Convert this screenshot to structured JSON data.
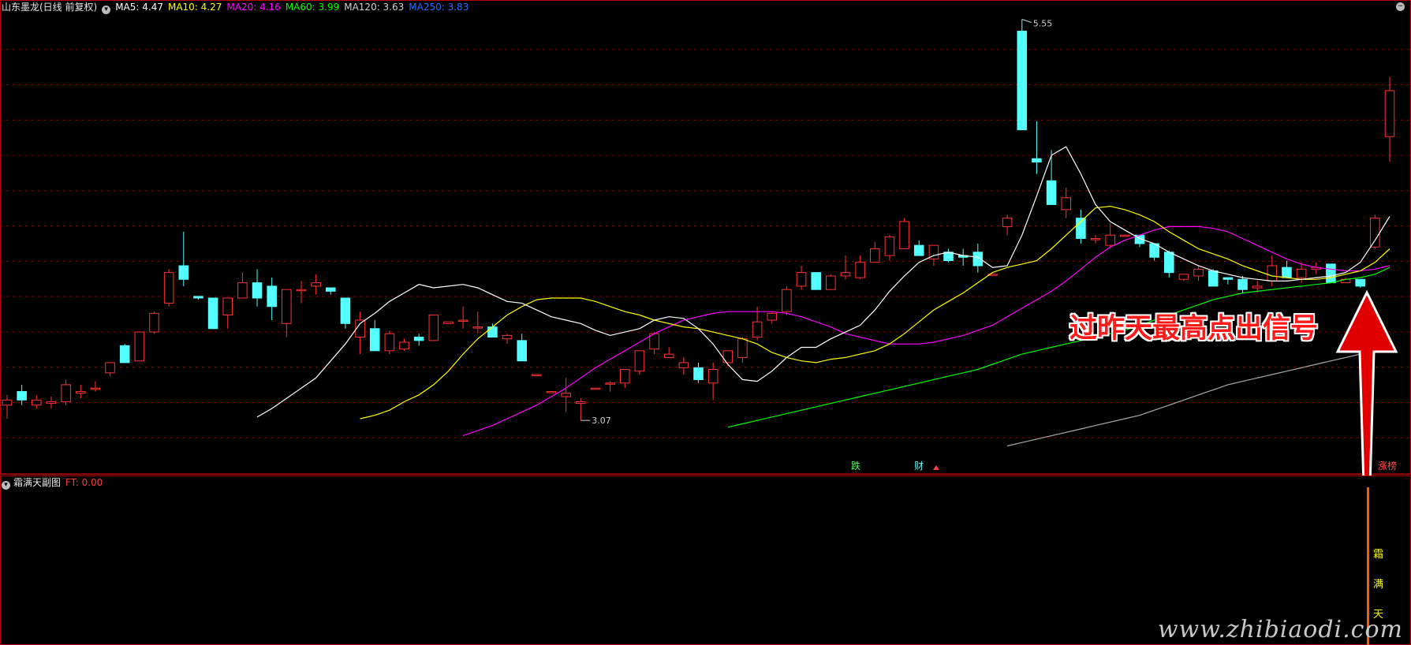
{
  "header": {
    "stock_name": "山东墨龙(日线 前复权)",
    "ma_items": [
      {
        "label": "MA5: 4.47",
        "color": "#ffffff"
      },
      {
        "label": "MA10: 4.27",
        "color": "#ffff00"
      },
      {
        "label": "MA20: 4.16",
        "color": "#ff00ff"
      },
      {
        "label": "MA60: 3.99",
        "color": "#00ff00"
      },
      {
        "label": "MA120: 3.63",
        "color": "#d0d0d0"
      },
      {
        "label": "MA250: 3.83",
        "color": "#1e6fff"
      }
    ]
  },
  "events": {
    "die": "跌",
    "cai": "财",
    "zhangting": "涨榜"
  },
  "signal_label": "过昨天最高点出信号",
  "sub_panel": {
    "title": "霜满天副图",
    "ft_label": "FT: 0.00",
    "vertical_chars": [
      "霜",
      "满",
      "天"
    ]
  },
  "watermark": "www.zhibiaodi.com",
  "chart_data": {
    "type": "candlestick",
    "ylim": [
      2.9,
      5.6
    ],
    "high_label": "5.55",
    "low_label": "3.07",
    "colors": {
      "up": "#ff3232",
      "down": "#54ffff",
      "ma5": "#ffffff",
      "ma10": "#ffff00",
      "ma20": "#ff00ff",
      "ma60": "#00ff00",
      "ma120": "#c8c8c8"
    },
    "candles": [
      {
        "o": 3.3,
        "h": 3.36,
        "l": 3.22,
        "c": 3.33
      },
      {
        "o": 3.38,
        "h": 3.42,
        "l": 3.3,
        "c": 3.33
      },
      {
        "o": 3.3,
        "h": 3.36,
        "l": 3.28,
        "c": 3.33
      },
      {
        "o": 3.31,
        "h": 3.35,
        "l": 3.28,
        "c": 3.32
      },
      {
        "o": 3.32,
        "h": 3.45,
        "l": 3.3,
        "c": 3.42
      },
      {
        "o": 3.37,
        "h": 3.42,
        "l": 3.34,
        "c": 3.38
      },
      {
        "o": 3.4,
        "h": 3.44,
        "l": 3.38,
        "c": 3.4
      },
      {
        "o": 3.49,
        "h": 3.54,
        "l": 3.47,
        "c": 3.55
      },
      {
        "o": 3.65,
        "h": 3.66,
        "l": 3.55,
        "c": 3.55
      },
      {
        "o": 3.56,
        "h": 3.72,
        "l": 3.56,
        "c": 3.73
      },
      {
        "o": 3.73,
        "h": 3.85,
        "l": 3.72,
        "c": 3.84
      },
      {
        "o": 3.9,
        "h": 4.1,
        "l": 3.88,
        "c": 4.08
      },
      {
        "o": 4.12,
        "h": 4.32,
        "l": 4.0,
        "c": 4.04
      },
      {
        "o": 3.94,
        "h": 3.94,
        "l": 3.92,
        "c": 3.93
      },
      {
        "o": 3.93,
        "h": 3.8,
        "l": 3.75,
        "c": 3.75
      },
      {
        "o": 3.83,
        "h": 3.9,
        "l": 3.75,
        "c": 3.93
      },
      {
        "o": 3.93,
        "h": 4.08,
        "l": 3.93,
        "c": 4.02
      },
      {
        "o": 4.02,
        "h": 4.1,
        "l": 3.88,
        "c": 3.93
      },
      {
        "o": 4.0,
        "h": 4.05,
        "l": 3.8,
        "c": 3.88
      },
      {
        "o": 3.78,
        "h": 3.95,
        "l": 3.7,
        "c": 3.98
      },
      {
        "o": 3.98,
        "h": 4.03,
        "l": 3.9,
        "c": 3.98
      },
      {
        "o": 4.0,
        "h": 4.07,
        "l": 3.95,
        "c": 4.02
      },
      {
        "o": 3.99,
        "h": 3.99,
        "l": 3.95,
        "c": 3.97
      },
      {
        "o": 3.93,
        "h": 3.9,
        "l": 3.75,
        "c": 3.78
      },
      {
        "o": 3.7,
        "h": 3.85,
        "l": 3.6,
        "c": 3.8
      },
      {
        "o": 3.75,
        "h": 3.8,
        "l": 3.62,
        "c": 3.62
      },
      {
        "o": 3.62,
        "h": 3.74,
        "l": 3.6,
        "c": 3.72
      },
      {
        "o": 3.63,
        "h": 3.69,
        "l": 3.62,
        "c": 3.67
      },
      {
        "o": 3.7,
        "h": 3.72,
        "l": 3.65,
        "c": 3.68
      },
      {
        "o": 3.68,
        "h": 3.82,
        "l": 3.68,
        "c": 3.83
      },
      {
        "o": 3.78,
        "h": 3.79,
        "l": 3.78,
        "c": 3.79
      },
      {
        "o": 3.8,
        "h": 3.88,
        "l": 3.75,
        "c": 3.8
      },
      {
        "o": 3.76,
        "h": 3.85,
        "l": 3.72,
        "c": 3.76
      },
      {
        "o": 3.76,
        "h": 3.78,
        "l": 3.7,
        "c": 3.7
      },
      {
        "o": 3.69,
        "h": 3.72,
        "l": 3.66,
        "c": 3.71
      },
      {
        "o": 3.68,
        "h": 3.72,
        "l": 3.56,
        "c": 3.56
      },
      {
        "o": 3.48,
        "h": 3.48,
        "l": 3.48,
        "c": 3.48
      },
      {
        "o": 3.38,
        "h": 3.38,
        "l": 3.38,
        "c": 3.38
      },
      {
        "o": 3.35,
        "h": 3.46,
        "l": 3.26,
        "c": 3.37
      },
      {
        "o": 3.31,
        "h": 3.34,
        "l": 3.21,
        "c": 3.32
      },
      {
        "o": 3.4,
        "h": 3.4,
        "l": 3.4,
        "c": 3.4
      },
      {
        "o": 3.43,
        "h": 3.44,
        "l": 3.38,
        "c": 3.43
      },
      {
        "o": 3.43,
        "h": 3.5,
        "l": 3.4,
        "c": 3.51
      },
      {
        "o": 3.5,
        "h": 3.58,
        "l": 3.48,
        "c": 3.62
      },
      {
        "o": 3.63,
        "h": 3.73,
        "l": 3.6,
        "c": 3.72
      },
      {
        "o": 3.58,
        "h": 3.64,
        "l": 3.58,
        "c": 3.6
      },
      {
        "o": 3.52,
        "h": 3.58,
        "l": 3.48,
        "c": 3.55
      },
      {
        "o": 3.52,
        "h": 3.55,
        "l": 3.43,
        "c": 3.45
      },
      {
        "o": 3.43,
        "h": 3.55,
        "l": 3.33,
        "c": 3.51
      },
      {
        "o": 3.55,
        "h": 3.62,
        "l": 3.53,
        "c": 3.62
      },
      {
        "o": 3.58,
        "h": 3.7,
        "l": 3.55,
        "c": 3.69
      },
      {
        "o": 3.7,
        "h": 3.88,
        "l": 3.68,
        "c": 3.79
      },
      {
        "o": 3.8,
        "h": 3.85,
        "l": 3.78,
        "c": 3.84
      },
      {
        "o": 3.85,
        "h": 4.0,
        "l": 3.83,
        "c": 3.98
      },
      {
        "o": 4.0,
        "h": 4.12,
        "l": 3.98,
        "c": 4.08
      },
      {
        "o": 4.08,
        "h": 3.98,
        "l": 3.98,
        "c": 3.98
      },
      {
        "o": 3.98,
        "h": 4.07,
        "l": 3.98,
        "c": 4.06
      },
      {
        "o": 4.06,
        "h": 4.18,
        "l": 4.04,
        "c": 4.08
      },
      {
        "o": 4.05,
        "h": 4.18,
        "l": 4.04,
        "c": 4.14
      },
      {
        "o": 4.14,
        "h": 4.26,
        "l": 4.14,
        "c": 4.22
      },
      {
        "o": 4.18,
        "h": 4.3,
        "l": 4.15,
        "c": 4.29
      },
      {
        "o": 4.22,
        "h": 4.4,
        "l": 4.22,
        "c": 4.38
      },
      {
        "o": 4.24,
        "h": 4.27,
        "l": 4.18,
        "c": 4.18
      },
      {
        "o": 4.16,
        "h": 4.24,
        "l": 4.12,
        "c": 4.24
      },
      {
        "o": 4.2,
        "h": 4.22,
        "l": 4.14,
        "c": 4.15
      },
      {
        "o": 4.18,
        "h": 4.22,
        "l": 4.12,
        "c": 4.17
      },
      {
        "o": 4.2,
        "h": 4.25,
        "l": 4.08,
        "c": 4.12
      },
      {
        "o": 4.07,
        "h": 4.07,
        "l": 4.07,
        "c": 4.07
      },
      {
        "o": 4.35,
        "h": 4.42,
        "l": 4.3,
        "c": 4.4
      },
      {
        "o": 5.5,
        "h": 5.57,
        "l": 4.92,
        "c": 4.92
      },
      {
        "o": 4.75,
        "h": 4.97,
        "l": 4.66,
        "c": 4.73
      },
      {
        "o": 4.62,
        "h": 4.8,
        "l": 4.5,
        "c": 4.48
      },
      {
        "o": 4.45,
        "h": 4.58,
        "l": 4.4,
        "c": 4.52
      },
      {
        "o": 4.4,
        "h": 4.45,
        "l": 4.25,
        "c": 4.28
      },
      {
        "o": 4.28,
        "h": 4.3,
        "l": 4.25,
        "c": 4.28
      },
      {
        "o": 4.24,
        "h": 4.37,
        "l": 4.22,
        "c": 4.3
      },
      {
        "o": 4.3,
        "h": 4.3,
        "l": 4.29,
        "c": 4.3
      },
      {
        "o": 4.3,
        "h": 4.28,
        "l": 4.23,
        "c": 4.25
      },
      {
        "o": 4.25,
        "h": 4.25,
        "l": 4.15,
        "c": 4.17
      },
      {
        "o": 4.2,
        "h": 4.21,
        "l": 4.05,
        "c": 4.08
      },
      {
        "o": 4.04,
        "h": 4.07,
        "l": 4.03,
        "c": 4.07
      },
      {
        "o": 4.06,
        "h": 4.12,
        "l": 4.03,
        "c": 4.1
      },
      {
        "o": 4.09,
        "h": 4.1,
        "l": 4.0,
        "c": 4.0
      },
      {
        "o": 4.05,
        "h": 4.05,
        "l": 4.01,
        "c": 4.04
      },
      {
        "o": 4.04,
        "h": 4.06,
        "l": 3.96,
        "c": 3.98
      },
      {
        "o": 3.99,
        "h": 4.03,
        "l": 3.96,
        "c": 4.0
      },
      {
        "o": 4.03,
        "h": 4.18,
        "l": 4.0,
        "c": 4.12
      },
      {
        "o": 4.11,
        "h": 4.15,
        "l": 4.05,
        "c": 4.05
      },
      {
        "o": 4.05,
        "h": 4.14,
        "l": 4.02,
        "c": 4.1
      },
      {
        "o": 4.1,
        "h": 4.14,
        "l": 4.07,
        "c": 4.11
      },
      {
        "o": 4.13,
        "h": 4.13,
        "l": 4.02,
        "c": 4.02
      },
      {
        "o": 4.02,
        "h": 4.05,
        "l": 4.02,
        "c": 4.04
      },
      {
        "o": 4.04,
        "h": 4.03,
        "l": 3.99,
        "c": 4.0
      },
      {
        "o": 4.23,
        "h": 4.42,
        "l": 4.22,
        "c": 4.4
      },
      {
        "o": 4.88,
        "h": 5.23,
        "l": 4.73,
        "c": 5.15
      }
    ],
    "ma5": [
      3.23,
      3.28,
      3.34,
      3.4,
      3.46,
      3.56,
      3.66,
      3.78,
      3.84,
      3.91,
      3.96,
      4.01,
      3.99,
      4.0,
      4.01,
      3.99,
      3.95,
      3.91,
      3.9,
      3.86,
      3.82,
      3.8,
      3.78,
      3.74,
      3.71,
      3.73,
      3.75,
      3.8,
      3.82,
      3.81,
      3.75,
      3.66,
      3.54,
      3.45,
      3.44,
      3.5,
      3.58,
      3.64,
      3.64,
      3.69,
      3.73,
      3.77,
      3.86,
      3.97,
      4.06,
      4.14,
      4.18,
      4.2,
      4.18,
      4.17,
      4.11,
      4.12,
      4.3,
      4.53,
      4.77,
      4.82,
      4.66,
      4.48,
      4.38,
      4.33,
      4.28,
      4.25,
      4.2,
      4.16,
      4.12,
      4.09,
      4.07,
      4.05,
      4.04,
      4.03,
      4.03,
      4.04,
      4.05,
      4.06,
      4.08,
      4.14,
      4.27,
      4.41
    ],
    "ma10": [
      3.22,
      3.24,
      3.27,
      3.32,
      3.36,
      3.42,
      3.5,
      3.6,
      3.69,
      3.76,
      3.83,
      3.88,
      3.92,
      3.93,
      3.93,
      3.93,
      3.91,
      3.88,
      3.85,
      3.83,
      3.8,
      3.78,
      3.76,
      3.75,
      3.73,
      3.71,
      3.69,
      3.66,
      3.61,
      3.58,
      3.56,
      3.55,
      3.57,
      3.58,
      3.6,
      3.62,
      3.66,
      3.72,
      3.79,
      3.86,
      3.91,
      3.96,
      4.02,
      4.08,
      4.11,
      4.13,
      4.15,
      4.22,
      4.3,
      4.38,
      4.46,
      4.47,
      4.45,
      4.42,
      4.38,
      4.32,
      4.27,
      4.22,
      4.19,
      4.16,
      4.12,
      4.09,
      4.06,
      4.05,
      4.04,
      4.04,
      4.05,
      4.07,
      4.09,
      4.14,
      4.22
    ],
    "ma20": [
      3.12,
      3.15,
      3.18,
      3.22,
      3.26,
      3.3,
      3.35,
      3.4,
      3.46,
      3.52,
      3.57,
      3.62,
      3.67,
      3.72,
      3.76,
      3.8,
      3.82,
      3.84,
      3.85,
      3.85,
      3.85,
      3.85,
      3.84,
      3.82,
      3.79,
      3.76,
      3.72,
      3.7,
      3.68,
      3.66,
      3.66,
      3.66,
      3.67,
      3.69,
      3.71,
      3.74,
      3.77,
      3.82,
      3.87,
      3.92,
      3.97,
      4.03,
      4.1,
      4.17,
      4.23,
      4.27,
      4.3,
      4.33,
      4.35,
      4.35,
      4.35,
      4.34,
      4.32,
      4.28,
      4.24,
      4.2,
      4.16,
      4.13,
      4.11,
      4.1,
      4.09,
      4.09,
      4.1,
      4.12
    ],
    "ma60": [
      3.17,
      3.19,
      3.21,
      3.23,
      3.25,
      3.27,
      3.29,
      3.31,
      3.33,
      3.35,
      3.37,
      3.39,
      3.41,
      3.43,
      3.45,
      3.47,
      3.49,
      3.51,
      3.54,
      3.57,
      3.6,
      3.62,
      3.64,
      3.66,
      3.68,
      3.7,
      3.72,
      3.74,
      3.77,
      3.8,
      3.83,
      3.86,
      3.89,
      3.92,
      3.94,
      3.96,
      3.97,
      3.98,
      3.99,
      4.0,
      4.01,
      4.02,
      4.04,
      4.05,
      4.07,
      4.11
    ],
    "ma120": [
      3.06,
      3.08,
      3.1,
      3.12,
      3.14,
      3.16,
      3.18,
      3.2,
      3.22,
      3.24,
      3.27,
      3.3,
      3.33,
      3.36,
      3.39,
      3.42,
      3.44,
      3.46,
      3.48,
      3.5,
      3.52,
      3.54,
      3.56,
      3.58,
      3.6,
      3.62,
      3.63
    ]
  }
}
